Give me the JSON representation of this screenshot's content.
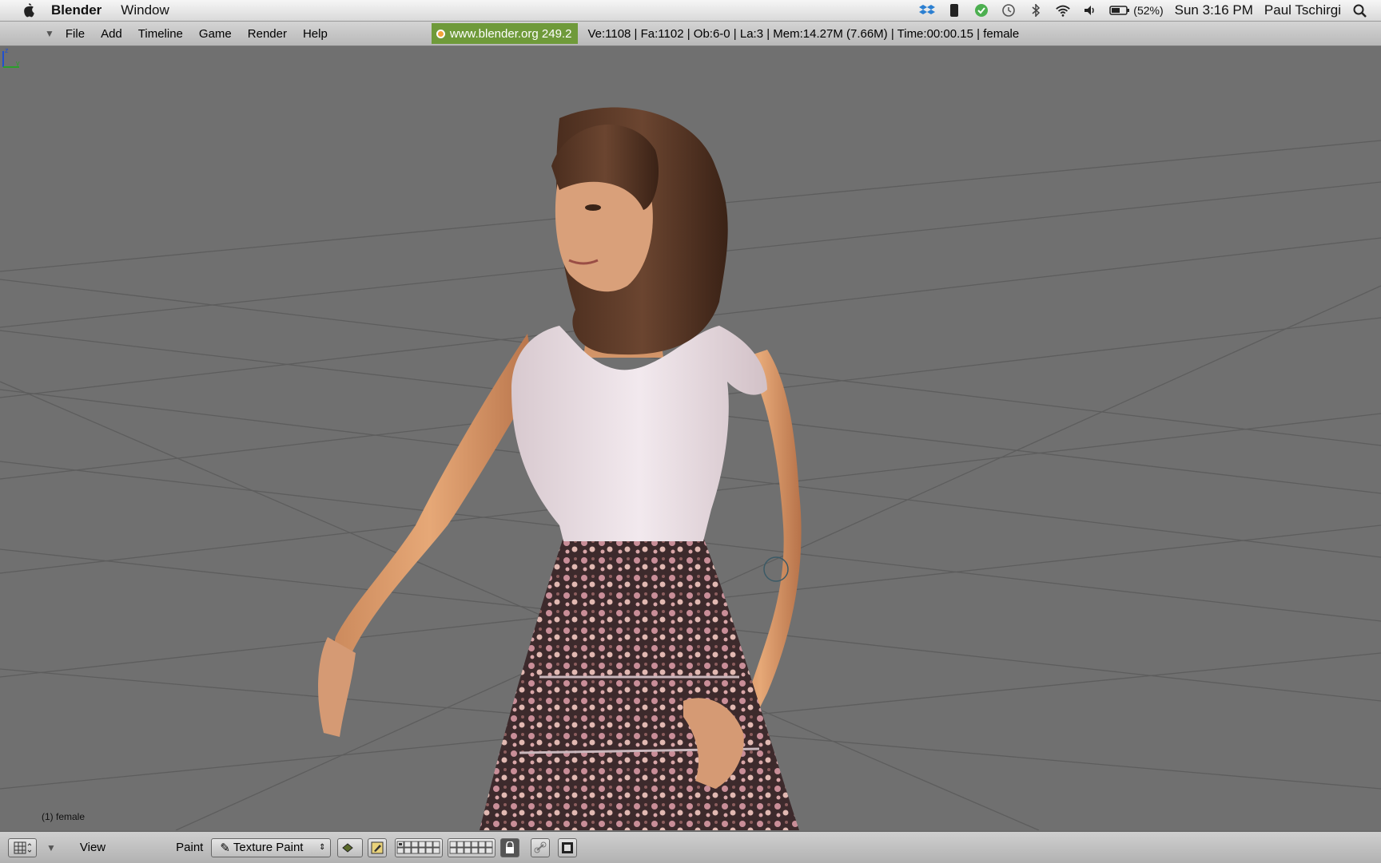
{
  "macos": {
    "app_name": "Blender",
    "menus": [
      "Window"
    ],
    "battery": "(52%)",
    "clock": "Sun 3:16 PM",
    "user": "Paul Tschirgi",
    "icons": [
      "dropbox-icon",
      "evernote-icon",
      "check-icon",
      "time-machine-icon",
      "bluetooth-icon",
      "wifi-icon",
      "volume-icon",
      "battery-icon",
      "spotlight-icon"
    ]
  },
  "blender_header": {
    "menus": [
      "File",
      "Add",
      "Timeline",
      "Game",
      "Render",
      "Help"
    ],
    "site": "www.blender.org 249.2",
    "stats": "Ve:1108 | Fa:1102 | Ob:6-0 | La:3  | Mem:14.27M (7.66M)  | Time:00:00.15 | female"
  },
  "viewport": {
    "object_label": "(1) female",
    "background": "#707070",
    "grid_color": "#5a5a5a"
  },
  "bottom_bar": {
    "view_label": "View",
    "mode_label": "Paint",
    "mode_value": "Texture Paint"
  }
}
